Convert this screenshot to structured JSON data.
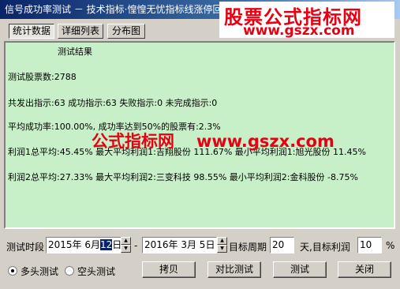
{
  "window": {
    "title": "信号成功率测试 － 技术指标·惶惶无忧指标线涨停回"
  },
  "watermarks": {
    "top_name": "股票公式指标网",
    "top_url": "www.gszx.com",
    "mid_name": "公式指标网",
    "mid_url": "www.gszx.com"
  },
  "tabs": [
    {
      "label": "统计数据"
    },
    {
      "label": "详细列表"
    },
    {
      "label": "分布图"
    }
  ],
  "results": {
    "heading": "测试结果",
    "stock_count": "测试股票数:2788",
    "signals": "共发出指示:63 成功指示:63 失败指示:0 未完成指示:0",
    "success_rate": "平均成功率:100.00%, 成功率达到50%的股票有:2.3%",
    "profit1": "利润1总平均:45.45% 最大平均利润1:吉翔股份 111.67% 最小平均利润1:旭光股份 11.45%",
    "profit2": "利润2总平均:27.33% 最大平均利润2:三变科技 98.55% 最小平均利润2:金科股份 -8.75%"
  },
  "params": {
    "period_label": "测试时段",
    "start_date_prefix": "2015年 6月",
    "start_date_selected": "12",
    "start_date_suffix": "日",
    "dash": "-",
    "end_date": "2016年 3月 5日",
    "target_period_label": "目标周期",
    "target_period_value": "20",
    "target_profit_label": "天,目标利润",
    "target_profit_value": "10",
    "percent": "%"
  },
  "mode": {
    "long_label": "多头测试",
    "short_label": "空头测试",
    "selected": "long"
  },
  "buttons": {
    "copy": "拷贝",
    "compare": "对比测试",
    "test": "测试",
    "close": "关闭"
  }
}
